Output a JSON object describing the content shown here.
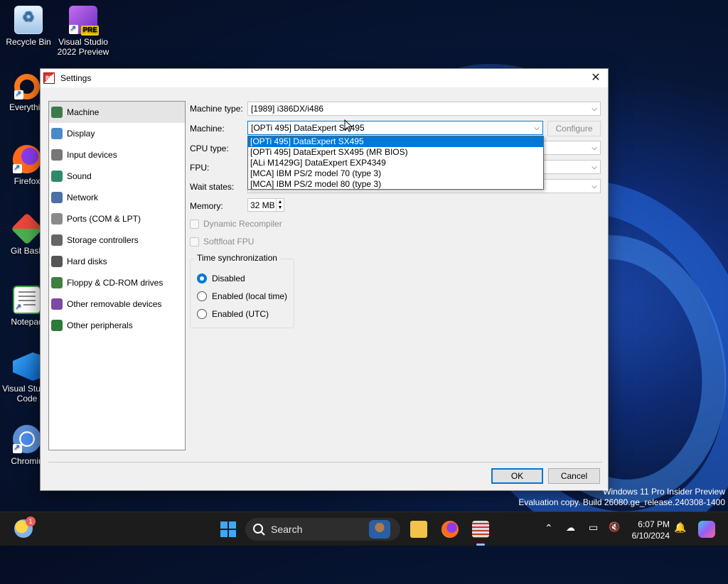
{
  "desktop": {
    "icons": [
      {
        "label": "Recycle Bin",
        "icon": "recycle-bin-icon"
      },
      {
        "label": "Visual Studio 2022 Preview",
        "icon": "visual-studio-icon",
        "badge": "PRE"
      },
      {
        "label": "Everythin",
        "icon": "everything-search-icon"
      },
      {
        "label": "Firefox",
        "icon": "firefox-icon"
      },
      {
        "label": "Git Bash",
        "icon": "git-bash-icon"
      },
      {
        "label": "Notepad",
        "icon": "notepad-icon"
      },
      {
        "label": "Visual Studio Code",
        "icon": "vscode-icon"
      },
      {
        "label": "Chromiu",
        "icon": "chromium-icon"
      }
    ],
    "watermark_line1": "Windows 11 Pro Insider Preview",
    "watermark_line2": "Evaluation copy. Build 26080.ge_release.240308-1400"
  },
  "window": {
    "title": "Settings",
    "close_glyph": "✕",
    "sidebar": [
      {
        "label": "Machine",
        "icon": "motherboard-icon",
        "active": true
      },
      {
        "label": "Display",
        "icon": "display-icon"
      },
      {
        "label": "Input devices",
        "icon": "input-devices-icon"
      },
      {
        "label": "Sound",
        "icon": "sound-icon"
      },
      {
        "label": "Network",
        "icon": "network-icon"
      },
      {
        "label": "Ports (COM & LPT)",
        "icon": "ports-icon"
      },
      {
        "label": "Storage controllers",
        "icon": "storage-controller-icon"
      },
      {
        "label": "Hard disks",
        "icon": "hard-disk-icon"
      },
      {
        "label": "Floppy & CD-ROM drives",
        "icon": "floppy-cdrom-icon"
      },
      {
        "label": "Other removable devices",
        "icon": "removable-device-icon"
      },
      {
        "label": "Other peripherals",
        "icon": "peripherals-icon"
      }
    ],
    "machine": {
      "machine_type_label": "Machine type:",
      "machine_type_value": "[1989] i386DX/i486",
      "machine_label": "Machine:",
      "machine_value": "[OPTi 495] DataExpert SX495",
      "configure_label": "Configure",
      "cpu_type_label": "CPU type:",
      "fpu_label": "FPU:",
      "wait_states_label": "Wait states:",
      "memory_label": "Memory:",
      "memory_value": "32 MB",
      "dynamic_recompiler_label": "Dynamic Recompiler",
      "softfloat_label": "Softfloat FPU",
      "time_sync_title": "Time synchronization",
      "time_sync_options": [
        {
          "label": "Disabled",
          "selected": true
        },
        {
          "label": "Enabled (local time)",
          "selected": false
        },
        {
          "label": "Enabled (UTC)",
          "selected": false
        }
      ],
      "machine_dropdown_options": [
        {
          "label": "[OPTi 495] DataExpert SX495",
          "selected": true
        },
        {
          "label": "[OPTi 495] DataExpert SX495 (MR BIOS)"
        },
        {
          "label": "[ALi M1429G] DataExpert EXP4349"
        },
        {
          "label": "[MCA] IBM PS/2 model 70 (type 3)"
        },
        {
          "label": "[MCA] IBM PS/2 model 80 (type 3)"
        }
      ]
    },
    "ok_label": "OK",
    "cancel_label": "Cancel"
  },
  "taskbar": {
    "search_label": "Search",
    "time": "6:07 PM",
    "date": "6/10/2024",
    "weather_badge": "1"
  },
  "colors": {
    "accent": "#0078d7"
  }
}
